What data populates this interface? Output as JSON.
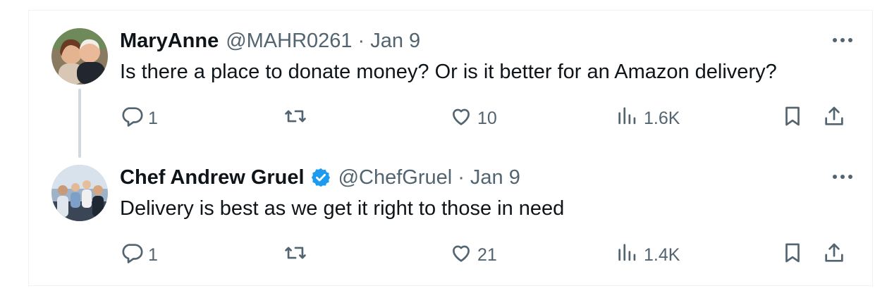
{
  "tweets": [
    {
      "name": "MaryAnne",
      "handle": "@MAHR0261",
      "separator": "·",
      "date": "Jan 9",
      "verified": false,
      "text": "Is there a place to donate money? Or is it better for an Amazon delivery?",
      "replies": "1",
      "retweets": "",
      "likes": "10",
      "views": "1.6K"
    },
    {
      "name": "Chef Andrew Gruel",
      "handle": "@ChefGruel",
      "separator": "·",
      "date": "Jan 9",
      "verified": true,
      "text": "Delivery is best as we get it right to those in need",
      "replies": "1",
      "retweets": "",
      "likes": "21",
      "views": "1.4K"
    }
  ],
  "colors": {
    "text": "#0f1419",
    "muted": "#536471",
    "verified": "#1d9bf0",
    "border": "#eff3f4",
    "thread": "#cfd9de"
  },
  "icons": [
    "reply-icon",
    "retweet-icon",
    "like-icon",
    "views-icon",
    "bookmark-icon",
    "share-icon",
    "more-icon",
    "verified-badge-icon"
  ]
}
